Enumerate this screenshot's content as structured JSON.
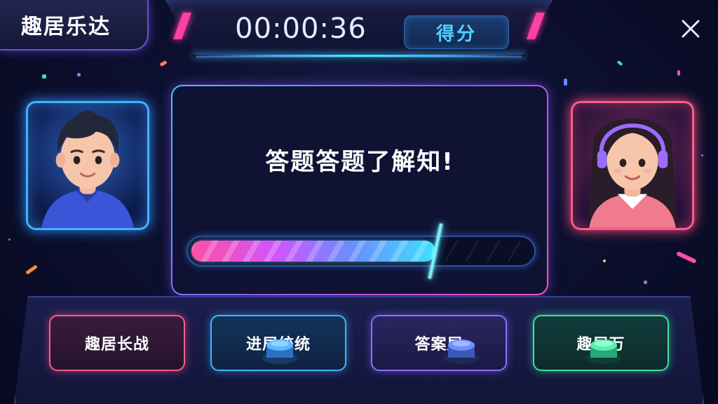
{
  "header": {
    "title": "趣居乐达",
    "timer": "00:00:36",
    "score_label": "得分"
  },
  "question": {
    "text": "答题答题了解知!",
    "progress_fraction": 0.72
  },
  "players": [
    {
      "side": "left",
      "frame_color": "#3fb4ff"
    },
    {
      "side": "right",
      "frame_color": "#ff5b8a"
    }
  ],
  "actions": [
    {
      "label": "趣居长战",
      "color": "#ff5b8c"
    },
    {
      "label": "进居统统",
      "color": "#3db6ff"
    },
    {
      "label": "答案居",
      "color": "#8a70ff"
    },
    {
      "label": "趣居万",
      "color": "#3fe0a6"
    }
  ],
  "icons": {
    "close": "close-icon",
    "buzzer": "buzzer-icon"
  }
}
